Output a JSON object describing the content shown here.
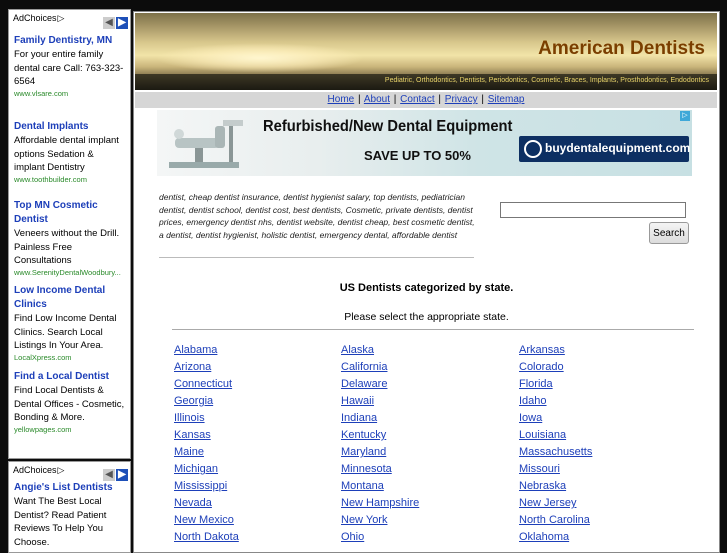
{
  "ads_top": {
    "choices_label": "AdChoices",
    "items": [
      {
        "title": "Family Dentistry, MN",
        "desc": "For your entire family dental care Call: 763-323-6564",
        "url": "www.vlsare.com"
      },
      {
        "title": "Dental Implants",
        "desc": "Affordable dental implant options Sedation & implant Dentistry",
        "url": "www.toothbuilder.com"
      },
      {
        "title": "Top MN Cosmetic Dentist",
        "desc": "Veneers without the Drill. Painless Free Consultations",
        "url": "www.SerenityDentalWoodbury..."
      },
      {
        "title": "Low Income Dental Clinics",
        "desc": "Find Low Income Dental Clinics. Search Local Listings In Your Area.",
        "url": "LocalXpress.com"
      },
      {
        "title": "Find a Local Dentist",
        "desc": "Find Local Dentists & Dental Offices - Cosmetic, Bonding & More.",
        "url": "yellowpages.com"
      }
    ]
  },
  "ads_bottom": {
    "choices_label": "AdChoices",
    "items": [
      {
        "title": "Angie's List Dentists",
        "desc": "Want The Best Local Dentist? Read Patient Reviews To Help You Choose.",
        "url": ""
      }
    ]
  },
  "header": {
    "title": "American Dentists",
    "tagline": "Pediatric, Orthodontics, Dentists, Periodontics, Cosmetic, Braces, Implants, Prosthodontics, Endodontics"
  },
  "nav": {
    "links": [
      "Home",
      "About",
      "Contact",
      "Privacy",
      "Sitemap"
    ],
    "separator": "|"
  },
  "promo": {
    "headline": "Refurbished/New Dental Equipment",
    "subline": "SAVE UP TO 50%",
    "brand": "buydentalequipment.com"
  },
  "keywords": "dentist, cheap dentist insurance, dentist hygienist salary, top dentists, pediatrician dentist, dentist school, dentist cost, best dentists, Cosmetic, private dentists, dentist prices, emergency dentist nhs, dentist website, dentist cheap, best cosmetic dentist, a dentist, dentist hygienist, holistic dentist, emergency dental, affordable dentist",
  "search": {
    "value": "",
    "button_label": "Search"
  },
  "categories": {
    "title": "US Dentists categorized by state.",
    "subtitle": "Please select the appropriate state.",
    "rows": [
      [
        "Alabama",
        "Alaska",
        "Arkansas"
      ],
      [
        "Arizona",
        "California",
        "Colorado"
      ],
      [
        "Connecticut",
        "Delaware",
        "Florida"
      ],
      [
        "Georgia",
        "Hawaii",
        "Idaho"
      ],
      [
        "Illinois",
        "Indiana",
        "Iowa"
      ],
      [
        "Kansas",
        "Kentucky",
        "Louisiana"
      ],
      [
        "Maine",
        "Maryland",
        "Massachusetts"
      ],
      [
        "Michigan",
        "Minnesota",
        "Missouri"
      ],
      [
        "Mississippi",
        "Montana",
        "Nebraska"
      ],
      [
        "Nevada",
        "New Hampshire",
        "New Jersey"
      ],
      [
        "New Mexico",
        "New York",
        "North Carolina"
      ],
      [
        "North Dakota",
        "Ohio",
        "Oklahoma"
      ]
    ]
  }
}
